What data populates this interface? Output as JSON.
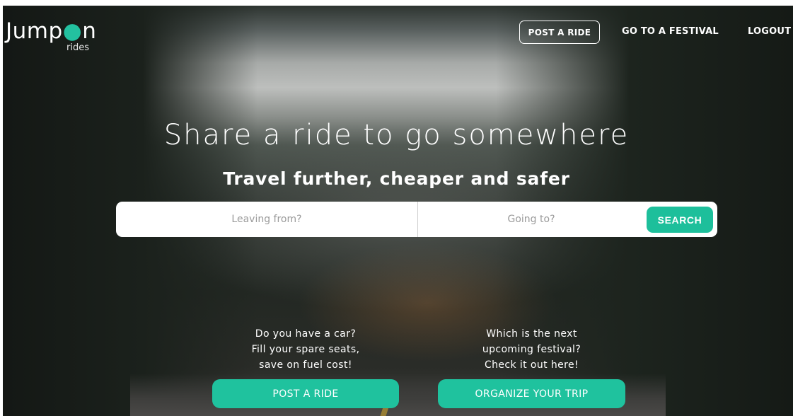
{
  "brand": {
    "name_pre": "Jump",
    "name_pin": "ı",
    "name_post": "n",
    "tagline": "rides",
    "accent": "#1dbf9b"
  },
  "nav": {
    "post_ride": "POST A RIDE",
    "festival": "GO TO A FESTIVAL",
    "logout": "LOGOUT"
  },
  "hero": {
    "title": "Share a ride to go somewhere",
    "subtitle": "Travel further, cheaper and safer"
  },
  "search": {
    "from_placeholder": "Leaving from?",
    "to_placeholder": "Going to?",
    "button": "SEARCH"
  },
  "promos": [
    {
      "lines": [
        "Do you have a car?",
        "Fill your spare seats,",
        "save on fuel cost!"
      ],
      "button": "POST A RIDE"
    },
    {
      "lines": [
        "Which is the next",
        "upcoming festival?",
        "Check it out here!"
      ],
      "button": "ORGANIZE YOUR TRIP"
    }
  ]
}
